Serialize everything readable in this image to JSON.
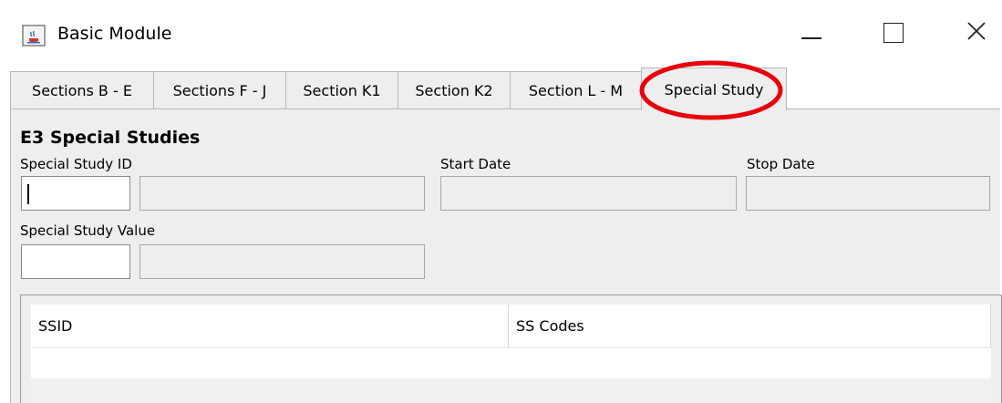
{
  "window": {
    "title": "Basic Module",
    "controls": {
      "minimize": "minimize",
      "maximize": "maximize",
      "close": "close"
    }
  },
  "tabs": [
    {
      "label": "Sections B - E",
      "active": false
    },
    {
      "label": "Sections F - J",
      "active": false
    },
    {
      "label": "Section K1",
      "active": false
    },
    {
      "label": "Section K2",
      "active": false
    },
    {
      "label": "Section L - M",
      "active": false
    },
    {
      "label": "Special Study",
      "active": true
    }
  ],
  "panel": {
    "section_title": "E3  Special Studies",
    "fields": {
      "special_study_id": {
        "label": "Special Study ID",
        "code_value": "",
        "description_value": ""
      },
      "start_date": {
        "label": "Start Date",
        "value": ""
      },
      "stop_date": {
        "label": "Stop Date",
        "value": ""
      },
      "special_study_value": {
        "label": "Special Study Value",
        "code_value": "",
        "description_value": ""
      }
    },
    "table": {
      "columns": [
        "SSID",
        "SS Codes"
      ],
      "rows": []
    }
  },
  "colors": {
    "highlight": "#e8000b",
    "panel_bg": "#eeeeee"
  },
  "icons": {
    "app": "java-coffee-icon",
    "minimize": "minimize-icon",
    "maximize": "maximize-icon",
    "close": "close-icon"
  }
}
